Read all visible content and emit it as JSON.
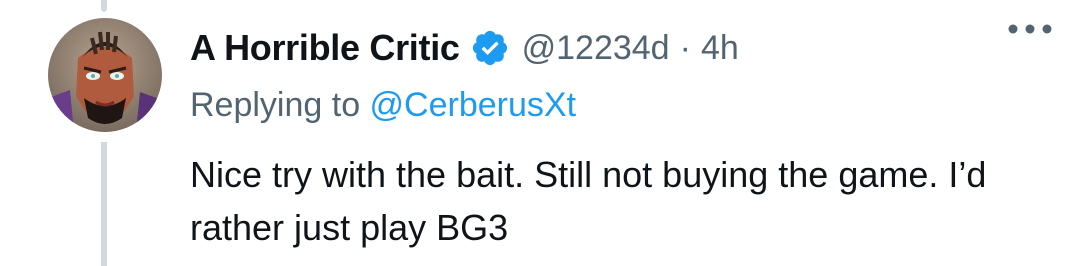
{
  "tweet": {
    "display_name": "A Horrible Critic",
    "handle": "@12234d",
    "separator": "·",
    "time": "4h",
    "replying_prefix": "Replying to ",
    "replying_to": "@CerberusXt",
    "text": "Nice try with the bait. Still not buying the game. I’d rather just play BG3"
  },
  "icons": {
    "verified": "verified-badge-icon",
    "more": "more-options-icon",
    "avatar": "avatar-image"
  },
  "colors": {
    "text": "#0f1419",
    "secondary": "#536471",
    "link": "#1d9bf0",
    "verified": "#1d9bf0",
    "thread_line": "#cfd9de"
  }
}
